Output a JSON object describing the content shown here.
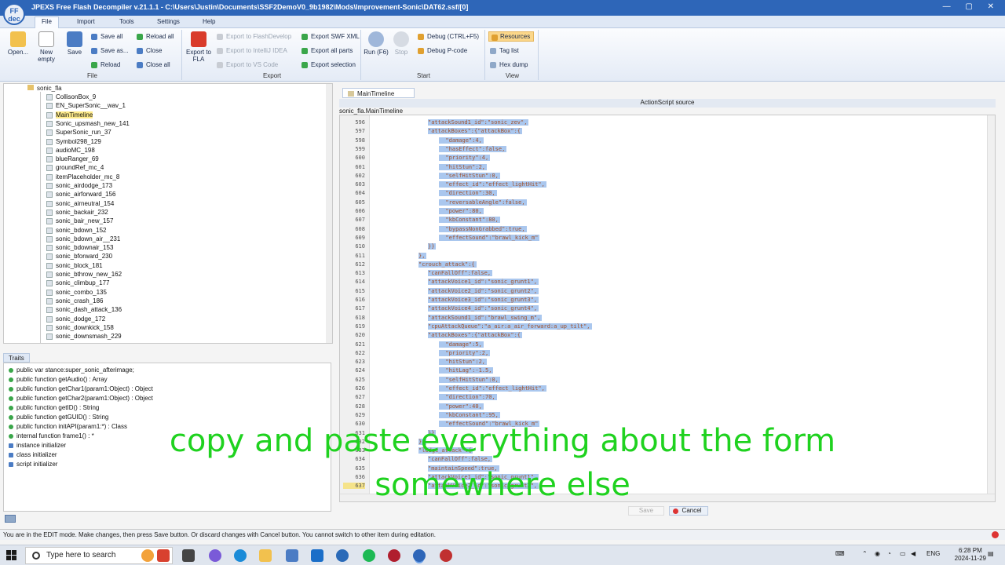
{
  "window": {
    "logo": "FF dec",
    "title": "JPEXS Free Flash Decompiler v.21.1.1 - C:\\Users\\Justin\\Documents\\SSF2DemoV0_9b1982\\Mods\\Improvement-Sonic\\DAT62.ssf/[0]",
    "controls": "— ▢ ✕"
  },
  "ribbon_tabs": [
    "File",
    "Import",
    "Tools",
    "Settings",
    "Help"
  ],
  "ribbon": {
    "file_group": "File",
    "open": "Open...",
    "new_empty": "New empty",
    "save": "Save",
    "save_all": "Save all",
    "save_as": "Save as...",
    "reload": "Reload",
    "reload_all": "Reload all",
    "close": "Close",
    "close_all": "Close all",
    "export_group": "Export",
    "export_to_fla": "Export to FLA",
    "export_flashdevelop": "Export to FlashDevelop",
    "export_intellij": "Export to IntelliJ IDEA",
    "export_vscode": "Export to VS Code",
    "export_swf_xml": "Export SWF XML",
    "export_all_parts": "Export all parts",
    "export_selection": "Export selection",
    "start_group": "Start",
    "run": "Run (F6)",
    "stop": "Stop",
    "debug": "Debug (CTRL+F5)",
    "debug_pcode": "Debug P-code",
    "view_group": "View",
    "resources": "Resources",
    "tag_list": "Tag list",
    "hex_dump": "Hex dump"
  },
  "tree": {
    "root": "sonic_fla",
    "items": [
      "CollisonBox_9",
      "EN_SuperSonic__wav_1",
      "MainTimeline",
      "Sonic_upsmash_new_141",
      "SuperSonic_run_37",
      "Symbol298_129",
      "audioMC_198",
      "blueRanger_69",
      "groundRef_mc_4",
      "itemPlaceholder_mc_8",
      "sonic_airdodge_173",
      "sonic_airforward_156",
      "sonic_airneutral_154",
      "sonic_backair_232",
      "sonic_bair_new_157",
      "sonic_bdown_152",
      "sonic_bdown_air__231",
      "sonic_bdownair_153",
      "sonic_bforward_230",
      "sonic_block_181",
      "sonic_bthrow_new_162",
      "sonic_climbup_177",
      "sonic_combo_135",
      "sonic_crash_186",
      "sonic_dash_attack_136",
      "sonic_dodge_172",
      "sonic_downkick_158",
      "sonic_downsmash_229"
    ],
    "selected": "MainTimeline"
  },
  "traits": {
    "tab": "Traits",
    "items": [
      "public var stance:super_sonic_afterimage;",
      "public function getAudio() : Array",
      "public function getChar1(param1:Object) : Object",
      "public function getChar2(param1:Object) : Object",
      "public function getID() : String",
      "public function getGUID() : String",
      "public function initAPI(param1:*) : Class",
      "internal function frame1() : *",
      "instance initializer",
      "class initializer",
      "script initializer"
    ]
  },
  "editor": {
    "tab": "MainTimeline",
    "header": "ActionScript source",
    "breadcrumb": "sonic_fla.MainTimeline",
    "lines": [
      {
        "n": "596",
        "t": "\"attackSound1_id\":\"sonic_zev\","
      },
      {
        "n": "597",
        "t": "\"attackBoxes\":{\"attackBox\":{"
      },
      {
        "n": "598",
        "t": "  \"damage\":4,"
      },
      {
        "n": "599",
        "t": "  \"hasEffect\":false,"
      },
      {
        "n": "600",
        "t": "  \"priority\":4,"
      },
      {
        "n": "601",
        "t": "  \"hitStun\":2,"
      },
      {
        "n": "602",
        "t": "  \"selfHitStun\":0,"
      },
      {
        "n": "603",
        "t": "  \"effect_id\":\"effect_lightHit\","
      },
      {
        "n": "604",
        "t": "  \"direction\":30,"
      },
      {
        "n": "605",
        "t": "  \"reversableAngle\":false,"
      },
      {
        "n": "606",
        "t": "  \"power\":80,"
      },
      {
        "n": "607",
        "t": "  \"kbConstant\":80,"
      },
      {
        "n": "608",
        "t": "  \"bypassNonGrabbed\":true,"
      },
      {
        "n": "609",
        "t": "  \"effectSound\":\"brawl_kick_m\""
      },
      {
        "n": "610",
        "t": "}}"
      },
      {
        "n": "611",
        "t": "},"
      },
      {
        "n": "612",
        "t": "\"crouch_attack\":{"
      },
      {
        "n": "613",
        "t": "\"canFallOff\":false,"
      },
      {
        "n": "614",
        "t": "\"attackVoice1_id\":\"sonic_grunt1\","
      },
      {
        "n": "615",
        "t": "\"attackVoice2_id\":\"sonic_grunt2\","
      },
      {
        "n": "616",
        "t": "\"attackVoice3_id\":\"sonic_grunt3\","
      },
      {
        "n": "617",
        "t": "\"attackVoice4_id\":\"sonic_grunt4\","
      },
      {
        "n": "618",
        "t": "\"attackSound1_id\":\"brawl_swing_m\","
      },
      {
        "n": "619",
        "t": "\"cpuAttackQueue\":\"a_air:a_air_forward:a_up_tilt\","
      },
      {
        "n": "620",
        "t": "\"attackBoxes\":{\"attackBox\":{"
      },
      {
        "n": "621",
        "t": "  \"damage\":5,"
      },
      {
        "n": "622",
        "t": "  \"priority\":2,"
      },
      {
        "n": "623",
        "t": "  \"hitStun\":2,"
      },
      {
        "n": "624",
        "t": "  \"hitLag\":-1.5,"
      },
      {
        "n": "625",
        "t": "  \"selfHitStun\":0,"
      },
      {
        "n": "626",
        "t": "  \"effect_id\":\"effect_lightHit\","
      },
      {
        "n": "627",
        "t": "  \"direction\":70,"
      },
      {
        "n": "628",
        "t": "  \"power\":40,"
      },
      {
        "n": "629",
        "t": "  \"kbConstant\":95,"
      },
      {
        "n": "630",
        "t": "  \"effectSound\":\"brawl_kick_m\""
      },
      {
        "n": "631",
        "t": "}}"
      },
      {
        "n": "632",
        "t": "},"
      },
      {
        "n": "633",
        "t": "\"ledge_attack\":{"
      },
      {
        "n": "634",
        "t": "\"canFallOff\":false,"
      },
      {
        "n": "635",
        "t": "\"maintainSpeed\":true,"
      },
      {
        "n": "636",
        "t": "\"attackVoice1_id\":\"sonic_grunt1\","
      },
      {
        "n": "637",
        "t": "\"attackVoice2_id\":\"sonic_grunt2\","
      }
    ],
    "current_line": "637",
    "save": "Save",
    "cancel": "Cancel"
  },
  "status_text": "You are in the EDIT mode. Make changes, then press Save button. Or discard changes with Cancel button. You cannot switch to other item during editation.",
  "caption": "copy and paste everything about the form somewhere else",
  "taskbar": {
    "search_placeholder": "Type here to search",
    "language": "ENG",
    "time": "6:28 PM",
    "date": "2024-11-29"
  }
}
